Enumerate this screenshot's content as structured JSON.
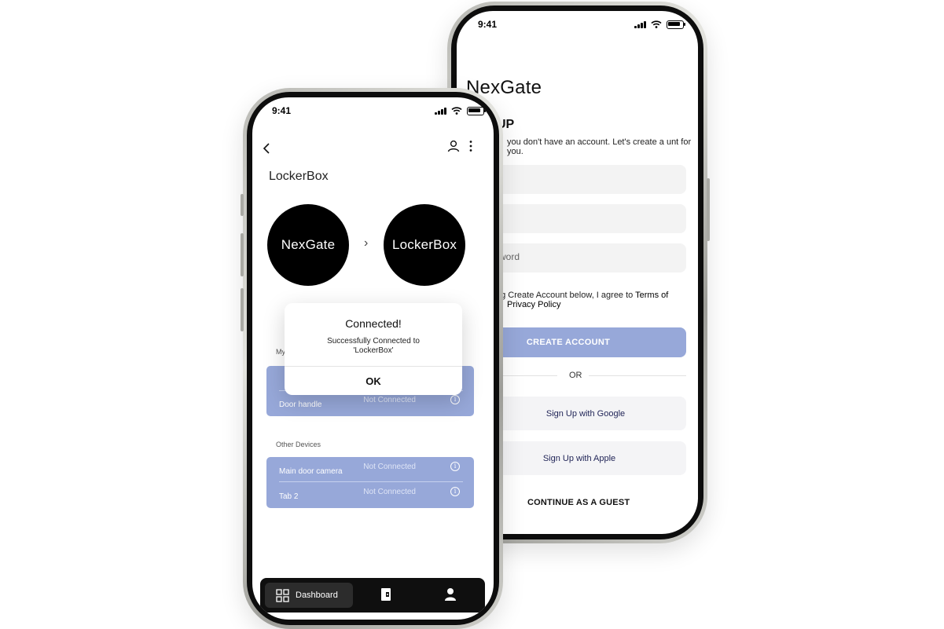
{
  "signup_screen": {
    "status_time": "9:41",
    "brand": "NexGate",
    "heading": "UP",
    "description": "you don't have an account. Let's create a unt for you.",
    "fields": [
      {
        "placeholder": ""
      },
      {
        "placeholder": ""
      },
      {
        "placeholder": "word"
      }
    ],
    "terms_prefix": "ng Create Account below, I agree to",
    "terms_link": "Terms of",
    "privacy_link": "Privacy Policy",
    "create_button": "CREATE ACCOUNT",
    "or_label": "OR",
    "google_button": "Sign Up with Google",
    "apple_button": "Sign Up with Apple",
    "guest_button": "CONTINUE AS A GUEST"
  },
  "dashboard_screen": {
    "status_time": "9:41",
    "title": "LockerBox",
    "source_logo": "NexGate",
    "target_logo": "LockerBox",
    "arrow_glyph": "›",
    "my_devices_label": "My",
    "my_devices": [
      {
        "name": "Door handle",
        "status": "Not Connected"
      }
    ],
    "other_devices_label": "Other Devices",
    "other_devices": [
      {
        "name": "Main door camera",
        "status": "Not Connected"
      },
      {
        "name": "Tab 2",
        "status": "Not Connected"
      }
    ],
    "info_glyph": "i",
    "dialog": {
      "title": "Connected!",
      "message": "Successfully Connected to 'LockerBox'",
      "ok": "OK"
    },
    "nav": {
      "dashboard_label": "Dashboard",
      "dashboard_icon": "grid-icon",
      "lock_icon": "door-lock-icon",
      "profile_icon": "person-icon"
    }
  },
  "colors": {
    "accent": "#97a8d9",
    "nav_bg": "#0f0f0f",
    "logo_bg": "#000000"
  }
}
